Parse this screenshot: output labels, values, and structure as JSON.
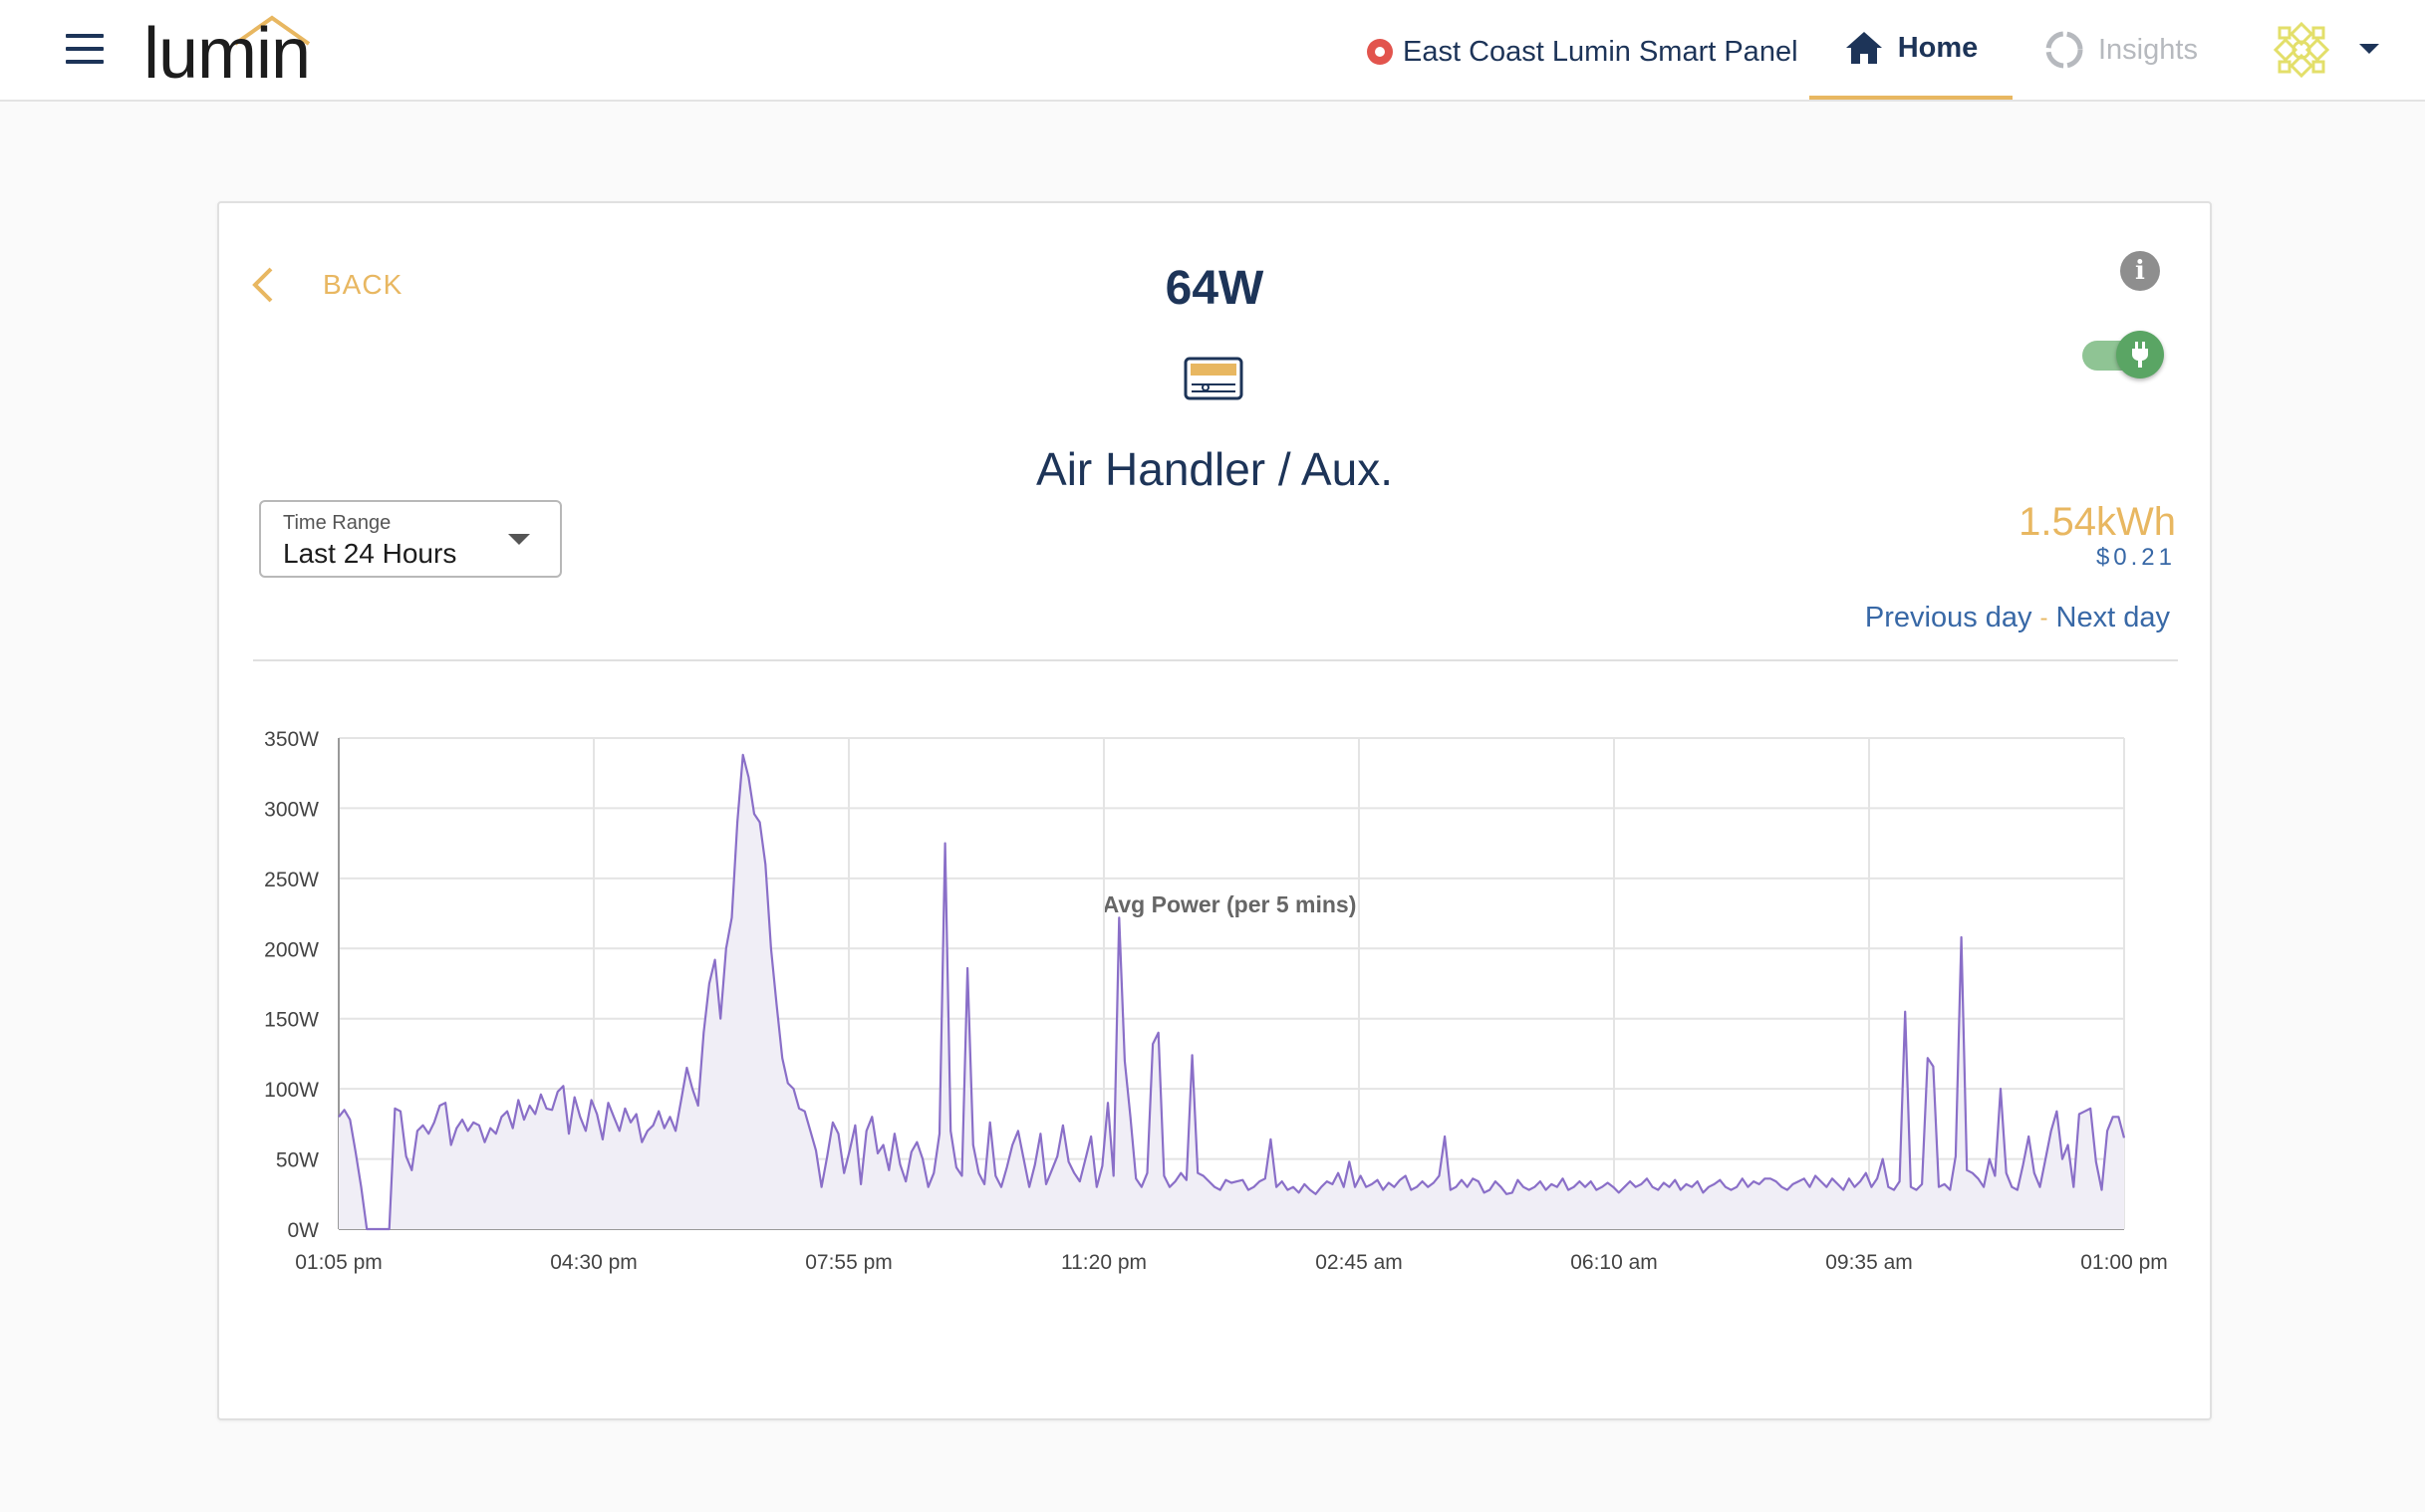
{
  "header": {
    "logo_text": "lumin",
    "panel_name": "East Coast Lumin Smart Panel",
    "nav": {
      "home": "Home",
      "insights": "Insights"
    }
  },
  "device": {
    "back_label": "BACK",
    "current_power": "64W",
    "name": "Air Handler / Aux.",
    "info_icon": "i",
    "toggle_on": true,
    "energy": "1.54kWh",
    "cost": "$0.21",
    "previous_day": "Previous day",
    "next_day": "Next day",
    "day_separator": "-"
  },
  "time_range": {
    "label": "Time Range",
    "value": "Last 24 Hours"
  },
  "colors": {
    "navy": "#1d3458",
    "accent": "#e8b761",
    "link": "#3868a6",
    "line": "#8a6fc8",
    "fill": "#f0eef6",
    "status_red": "#e2544d",
    "toggle_green": "#5aa564"
  },
  "chart_data": {
    "type": "area",
    "title": "Avg Power (per 5 mins)",
    "ylabel": "",
    "xlabel": "",
    "unit": "W",
    "ylim": [
      0,
      350
    ],
    "yticks": [
      "0W",
      "50W",
      "100W",
      "150W",
      "200W",
      "250W",
      "300W",
      "350W"
    ],
    "xticks": [
      "01:05 pm",
      "04:30 pm",
      "07:55 pm",
      "11:20 pm",
      "02:45 am",
      "06:10 am",
      "09:35 am",
      "01:00 pm"
    ],
    "grid": true,
    "series": [
      {
        "values": [
          80,
          85,
          78,
          55,
          30,
          0,
          0,
          0,
          0,
          0,
          86,
          84,
          52,
          42,
          70,
          74,
          68,
          76,
          88,
          90,
          60,
          72,
          78,
          70,
          76,
          74,
          62,
          72,
          68,
          80,
          84,
          72,
          92,
          78,
          88,
          82,
          96,
          86,
          85,
          98,
          102,
          68,
          94,
          80,
          70,
          92,
          82,
          64,
          90,
          80,
          70,
          86,
          76,
          82,
          62,
          70,
          74,
          84,
          72,
          80,
          70,
          92,
          115,
          100,
          88,
          140,
          175,
          192,
          150,
          200,
          222,
          290,
          338,
          322,
          296,
          290,
          260,
          200,
          160,
          122,
          104,
          100,
          86,
          84,
          70,
          56,
          30,
          52,
          76,
          68,
          40,
          56,
          74,
          32,
          70,
          80,
          54,
          60,
          42,
          68,
          46,
          34,
          55,
          62,
          50,
          30,
          40,
          68,
          275,
          70,
          44,
          38,
          186,
          60,
          40,
          32,
          76,
          38,
          30,
          44,
          60,
          70,
          50,
          30,
          46,
          68,
          32,
          42,
          52,
          74,
          48,
          40,
          34,
          50,
          66,
          30,
          45,
          90,
          38,
          222,
          120,
          80,
          36,
          30,
          40,
          132,
          140,
          38,
          30,
          34,
          40,
          35,
          124,
          40,
          38,
          34,
          30,
          28,
          35,
          33,
          34,
          35,
          28,
          30,
          34,
          36,
          64,
          30,
          34,
          28,
          30,
          26,
          32,
          28,
          25,
          30,
          34,
          32,
          40,
          30,
          48,
          30,
          38,
          30,
          32,
          35,
          28,
          33,
          30,
          35,
          38,
          28,
          30,
          34,
          30,
          33,
          38,
          66,
          28,
          30,
          35,
          30,
          36,
          34,
          26,
          28,
          34,
          30,
          25,
          26,
          35,
          30,
          28,
          30,
          34,
          28,
          32,
          30,
          36,
          28,
          30,
          34,
          30,
          34,
          28,
          30,
          33,
          30,
          26,
          30,
          34,
          30,
          32,
          36,
          30,
          28,
          33,
          30,
          35,
          28,
          32,
          30,
          34,
          26,
          30,
          32,
          35,
          30,
          28,
          30,
          36,
          30,
          34,
          32,
          36,
          36,
          34,
          30,
          28,
          32,
          34,
          36,
          30,
          38,
          34,
          30,
          36,
          32,
          28,
          36,
          30,
          34,
          40,
          30,
          36,
          50,
          30,
          28,
          34,
          155,
          30,
          28,
          32,
          122,
          116,
          30,
          32,
          28,
          52,
          208,
          42,
          40,
          36,
          30,
          50,
          38,
          100,
          40,
          30,
          28,
          46,
          66,
          40,
          30,
          50,
          70,
          84,
          50,
          60,
          30,
          82,
          84,
          86,
          48,
          28,
          70,
          80,
          80,
          65
        ]
      }
    ]
  }
}
